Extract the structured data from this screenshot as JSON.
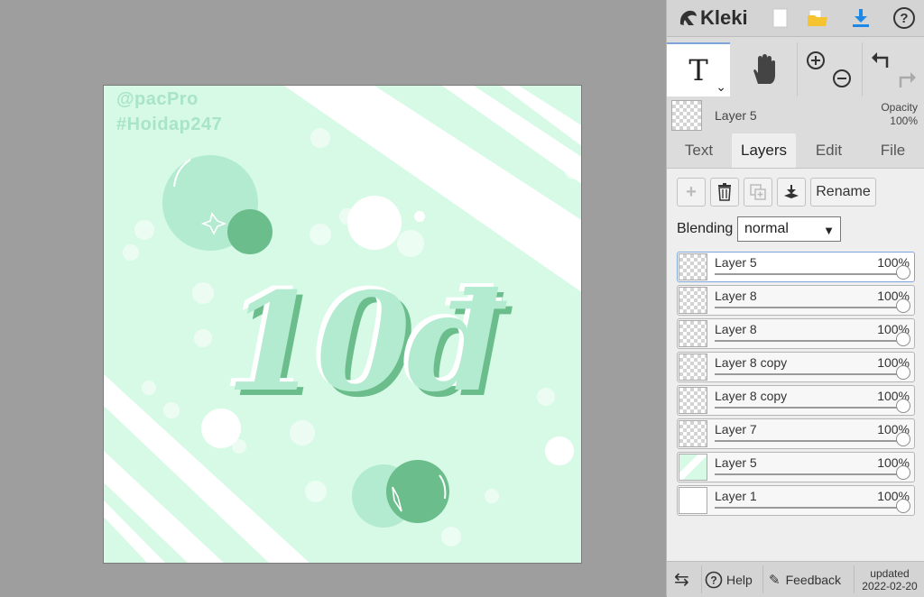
{
  "app": {
    "name": "Kleki"
  },
  "topbar": {
    "icons": [
      "new-image-icon",
      "open-folder-icon",
      "download-icon",
      "help-icon"
    ]
  },
  "toolbar": {
    "active_tool_glyph": "T",
    "icons": [
      "text-tool-icon",
      "hand-tool-icon",
      "zoom-in-icon",
      "zoom-out-icon",
      "undo-icon",
      "redo-icon"
    ]
  },
  "layer_info": {
    "name": "Layer 5",
    "opacity_label": "Opacity",
    "opacity_value": "100%"
  },
  "tabs": [
    {
      "label": "Text",
      "active": false
    },
    {
      "label": "Layers",
      "active": true
    },
    {
      "label": "Edit",
      "active": false
    },
    {
      "label": "File",
      "active": false
    }
  ],
  "layer_controls": {
    "rename_label": "Rename",
    "blending_label": "Blending",
    "blending_value": "normal"
  },
  "layers": [
    {
      "name": "Layer 5",
      "opacity": "100%",
      "selected": true
    },
    {
      "name": "Layer 8",
      "opacity": "100%",
      "selected": false
    },
    {
      "name": "Layer 8",
      "opacity": "100%",
      "selected": false
    },
    {
      "name": "Layer 8 copy",
      "opacity": "100%",
      "selected": false
    },
    {
      "name": "Layer 8 copy",
      "opacity": "100%",
      "selected": false
    },
    {
      "name": "Layer 7",
      "opacity": "100%",
      "selected": false
    },
    {
      "name": "Layer 5",
      "opacity": "100%",
      "selected": false
    },
    {
      "name": "Layer 1",
      "opacity": "100%",
      "selected": false
    }
  ],
  "canvas": {
    "watermark_line1": "@pacPro",
    "watermark_line2": "#Hoidap247",
    "lettering": "10đ"
  },
  "footer": {
    "help_label": "Help",
    "feedback_label": "Feedback",
    "updated_label": "updated",
    "updated_date": "2022-02-20"
  },
  "colors": {
    "canvas_bg": "#d6fae6",
    "mint": "#b3ebd0",
    "green": "#6bbd8c",
    "accent_blue": "#7ea4d9"
  }
}
